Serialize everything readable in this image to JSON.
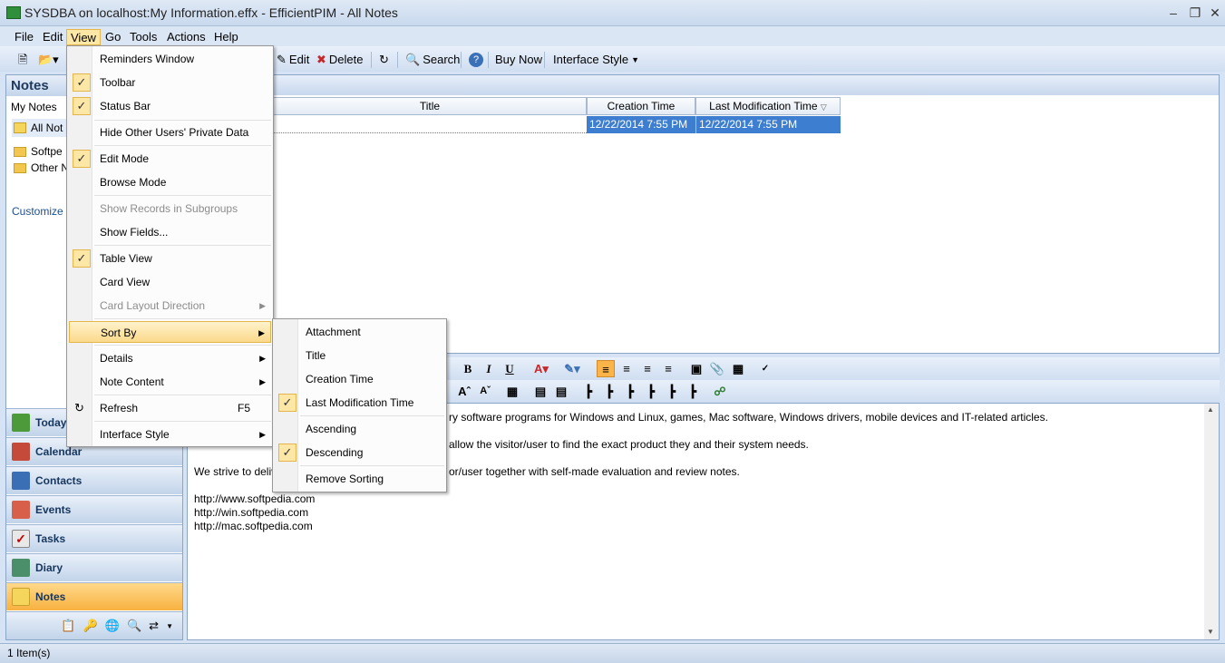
{
  "window": {
    "title": "SYSDBA on localhost:My Information.effx - EfficientPIM - All Notes"
  },
  "menubar": [
    "File",
    "Edit",
    "View",
    "Go",
    "Tools",
    "Actions",
    "Help"
  ],
  "toolbar": {
    "edit": "Edit",
    "delete": "Delete",
    "search": "Search",
    "buy": "Buy Now",
    "style": "Interface Style"
  },
  "notes_panel": {
    "header": "Notes",
    "my_notes": "My Notes",
    "all_notes": "All Not",
    "folder1": "Softpe",
    "folder2": "Other N",
    "customize": "Customize Cu"
  },
  "nav": [
    "Today",
    "Calendar",
    "Contacts",
    "Events",
    "Tasks",
    "Diary",
    "Notes"
  ],
  "grid": {
    "columns": [
      "Title",
      "Creation Time",
      "Last Modification Time"
    ],
    "row": {
      "creation": "12/22/2014 7:55 PM",
      "modified": "12/22/2014 7:55 PM"
    }
  },
  "editor": {
    "line1": "ry software programs for Windows and Linux, games, Mac software, Windows drivers, mobile devices and IT-related articles.",
    "line2": "allow the visitor/user to find the exact product they and their system needs.",
    "line3a": "We strive to deliv",
    "line3b": "or/user together with self-made evaluation and review notes.",
    "url1": "http://www.softpedia.com",
    "url2": "http://win.softpedia.com",
    "url3": "http://mac.softpedia.com"
  },
  "view_menu": [
    {
      "label": "Reminders Window"
    },
    {
      "label": "Toolbar"
    },
    {
      "label": "Status Bar"
    },
    {
      "label": "Hide Other Users' Private Data"
    },
    {
      "label": "Edit Mode"
    },
    {
      "label": "Browse Mode"
    },
    {
      "label": "Show Records in Subgroups"
    },
    {
      "label": "Show Fields..."
    },
    {
      "label": "Table View"
    },
    {
      "label": "Card View"
    },
    {
      "label": "Card Layout Direction"
    },
    {
      "label": "Sort By"
    },
    {
      "label": "Details"
    },
    {
      "label": "Note Content"
    },
    {
      "label": "Refresh",
      "shortcut": "F5"
    },
    {
      "label": "Interface Style"
    }
  ],
  "sort_menu": [
    "Attachment",
    "Title",
    "Creation Time",
    "Last Modification Time",
    "Ascending",
    "Descending",
    "Remove Sorting"
  ],
  "status": {
    "count": "1 Item(s)"
  },
  "colors": {
    "accent": "#3d7ed1",
    "highlight": "#fbd98a",
    "frame": "#d6e3f5"
  }
}
